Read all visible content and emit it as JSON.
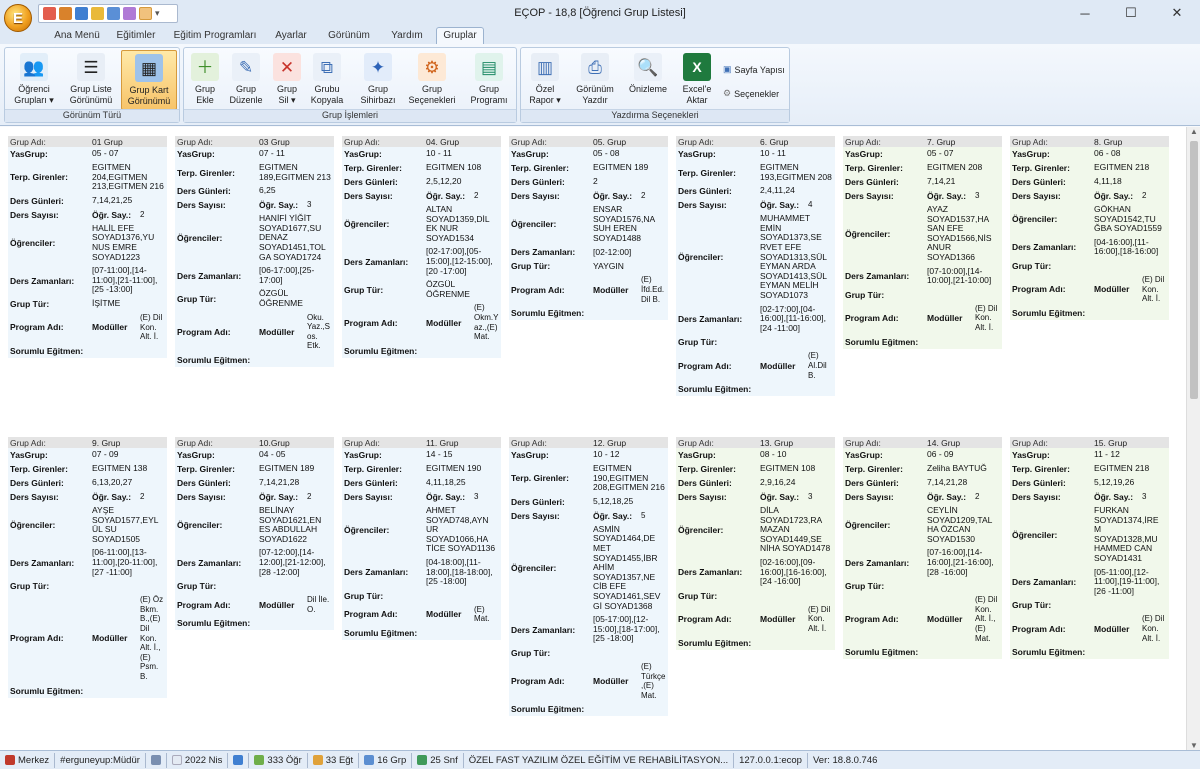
{
  "window": {
    "title": "EÇOP - 18,8 [Öğrenci Grup Listesi]",
    "logo_letter": "E",
    "minimize": "─",
    "maximize": "☐",
    "close": "✕"
  },
  "tabs": [
    "Ana Menü",
    "Eğitimler",
    "Eğitim Programları",
    "Ayarlar",
    "Görünüm",
    "Yardım",
    "Gruplar"
  ],
  "ribbon": {
    "gorunum": {
      "label": "Görünüm Türü",
      "buttons": [
        [
          "Öğrenci",
          "Grupları ▾"
        ],
        [
          "Grup Liste",
          "Görünümü"
        ],
        [
          "Grup Kart",
          "Görünümü"
        ]
      ]
    },
    "islemler": {
      "label": "Grup İşlemleri",
      "buttons": [
        [
          "Grup",
          "Ekle"
        ],
        [
          "Grup",
          "Düzenle"
        ],
        [
          "Grup",
          "Sil ▾"
        ],
        [
          "Grubu",
          "Kopyala"
        ],
        [
          "Grup",
          "Sihirbazı"
        ],
        [
          "Grup",
          "Seçenekleri"
        ],
        [
          "Grup",
          "Programı"
        ]
      ]
    },
    "yazdirma": {
      "label": "Yazdırma Seçenekleri",
      "buttons": [
        [
          "Özel",
          "Rapor ▾"
        ],
        [
          "Görünüm",
          "Yazdır"
        ],
        [
          "Önizleme",
          ""
        ],
        [
          "Excel'e",
          "Aktar"
        ]
      ],
      "sayfa": "Sayfa Yapısı",
      "secenekler": "Seçenekler"
    }
  },
  "labels": {
    "grup_adi": "Grup Adı",
    "yasgrup": "YasGrup",
    "terp": "Terp. Girenler",
    "ders_gunleri": "Ders Günleri",
    "ders_sayisi": "Ders Sayısı",
    "ogr_say": "Öğr. Say.:",
    "ogrenciler": "Öğrenciler",
    "ders_zamanlari": "Ders Zamanları",
    "grup_tur": "Grup Tür",
    "program_adi": "Program Adı",
    "moduller": "Modüller",
    "sorumlu": "Sorumlu Eğitmen"
  },
  "cards": [
    {
      "name": "01 Grup",
      "yas": "05 - 07",
      "terp": "EGITMEN 204,EGITMEN 213,EGITMEN 216",
      "gun": "7,14,21,25",
      "sayi": "",
      "ogr": "2",
      "ogrenciler": "HALİL EFE SOYAD1376,YU NUS EMRE SOYAD1223",
      "zaman": "[07-11:00],[14-11:00],[21-11:00],[25 -13:00]",
      "tur": "İŞİTME",
      "program": "",
      "modul": "(E) Dil Kon. Alt. İ.",
      "sorumlu": ""
    },
    {
      "name": "03 Grup",
      "yas": "07 - 11",
      "terp": "EGITMEN 189,EGITMEN 213",
      "gun": "6,25",
      "sayi": "",
      "ogr": "3",
      "ogrenciler": "HANİFİ YİĞİT SOYAD1677,SU DENAZ SOYAD1451,TOL GA SOYAD1724",
      "zaman": "[06-17:00],[25-17:00]",
      "tur": "ÖZGÜL ÖĞRENME",
      "program": "",
      "modul": "Oku. Yaz.,S os. Etk.",
      "sorumlu": ""
    },
    {
      "name": "04. Grup",
      "yas": "10 - 11",
      "terp": "EGITMEN 108",
      "gun": "2,5,12,20",
      "sayi": "",
      "ogr": "2",
      "ogrenciler": "ALTAN SOYAD1359,DİL EK NUR SOYAD1534",
      "zaman": "[02-17:00],[05-15:00],[12-15:00],[20 -17:00]",
      "tur": "ÖZGÜL ÖĞRENME",
      "program": "",
      "modul": "(E) Okm.Y az.,(E) Mat.",
      "sorumlu": ""
    },
    {
      "name": "05. Grup",
      "yas": "05 - 08",
      "terp": "EGITMEN 189",
      "gun": "2",
      "sayi": "",
      "ogr": "2",
      "ogrenciler": "ENSAR SOYAD1576,NA SUH EREN SOYAD1488",
      "zaman": "[02-12:00]",
      "tur": "YAYGIN",
      "program": "",
      "modul": "(E) İfd.Ed. Dil B.",
      "sorumlu": ""
    },
    {
      "name": "6. Grup",
      "yas": "10 - 11",
      "terp": "EGITMEN 193,EGITMEN 208",
      "gun": "2,4,11,24",
      "sayi": "",
      "ogr": "4",
      "ogrenciler": "MUHAMMET EMİN SOYAD1373,SE RVET EFE SOYAD1313,SÜL EYMAN ARDA SOYAD1413,SÜL EYMAN MELİH SOYAD1073",
      "zaman": "[02-17:00],[04-16:00],[11-16:00],[24 -11:00]",
      "tur": "",
      "program": "",
      "modul": "(E) Al.Dil B.",
      "sorumlu": ""
    },
    {
      "name": "7. Grup",
      "yas": "05 - 07",
      "terp": "EGITMEN 208",
      "gun": "7,14,21",
      "sayi": "",
      "ogr": "3",
      "ogrenciler": "AYAZ SOYAD1537,HA SAN EFE SOYAD1566,NİS ANUR SOYAD1366",
      "zaman": "[07-10:00],[14-10:00],[21-10:00]",
      "tur": "",
      "program": "",
      "modul": "(E) Dil Kon. Alt. İ.",
      "sorumlu": ""
    },
    {
      "name": "8. Grup",
      "yas": "06 - 08",
      "terp": "EGITMEN 218",
      "gun": "4,11,18",
      "sayi": "",
      "ogr": "2",
      "ogrenciler": "GÖKHAN SOYAD1542,TU ĞBA SOYAD1559",
      "zaman": "[04-16:00],[11-16:00],[18-16:00]",
      "tur": "",
      "program": "",
      "modul": "(E) Dil Kon. Alt. İ.",
      "sorumlu": ""
    },
    {
      "name": "9. Grup",
      "yas": "07 - 09",
      "terp": "EGITMEN 138",
      "gun": "6,13,20,27",
      "sayi": "",
      "ogr": "2",
      "ogrenciler": "AYŞE SOYAD1577,EYL ÜL SU SOYAD1505",
      "zaman": "[06-11:00],[13-11:00],[20-11:00],[27 -11:00]",
      "tur": "",
      "program": "",
      "modul": "(E) Öz Bkm. B.,(E) Dil Kon. Alt. İ.,(E) Psm. B.",
      "sorumlu": ""
    },
    {
      "name": "10.Grup",
      "yas": "04 - 05",
      "terp": "EGITMEN 189",
      "gun": "7,14,21,28",
      "sayi": "",
      "ogr": "2",
      "ogrenciler": "BELİNAY SOYAD1621,EN ES ABDULLAH SOYAD1622",
      "zaman": "[07-12:00],[14-12:00],[21-12:00],[28 -12:00]",
      "tur": "",
      "program": "",
      "modul": "Dil İle. O.",
      "sorumlu": ""
    },
    {
      "name": "11. Grup",
      "yas": "14 - 15",
      "terp": "EGITMEN 190",
      "gun": "4,11,18,25",
      "sayi": "",
      "ogr": "3",
      "ogrenciler": "AHMET SOYAD748,AYN UR SOYAD1066,HA TİCE SOYAD1136",
      "zaman": "[04-18:00],[11-18:00],[18-18:00],[25 -18:00]",
      "tur": "",
      "program": "",
      "modul": "(E) Mat.",
      "sorumlu": ""
    },
    {
      "name": "12. Grup",
      "yas": "10 - 12",
      "terp": "EGITMEN 190,EGITMEN 208,EGITMEN 216",
      "gun": "5,12,18,25",
      "sayi": "",
      "ogr": "5",
      "ogrenciler": "ASMİN SOYAD1464,DE MET SOYAD1455,İBR AHİM SOYAD1357,NE CİB EFE SOYAD1461,SEV Gİ SOYAD1368",
      "zaman": "[05-17:00],[12-15:00],[18-17:00],[25 -18:00]",
      "tur": "",
      "program": "",
      "modul": "(E) Türkçe ,(E) Mat.",
      "sorumlu": ""
    },
    {
      "name": "13. Grup",
      "yas": "08 - 10",
      "terp": "EGITMEN 108",
      "gun": "2,9,16,24",
      "sayi": "",
      "ogr": "3",
      "ogrenciler": "DİLA SOYAD1723,RA MAZAN SOYAD1449,SE NİHA SOYAD1478",
      "zaman": "[02-16:00],[09-16:00],[16-16:00],[24 -16:00]",
      "tur": "",
      "program": "",
      "modul": "(E) Dil Kon. Alt. İ.",
      "sorumlu": ""
    },
    {
      "name": "14. Grup",
      "yas": "06 - 09",
      "terp": "Zeliha BAYTUĞ",
      "gun": "7,14,21,28",
      "sayi": "",
      "ogr": "2",
      "ogrenciler": "CEYLİN SOYAD1209,TAL HA ÖZCAN SOYAD1530",
      "zaman": "[07-16:00],[14-16:00],[21-16:00],[28 -16:00]",
      "tur": "",
      "program": "",
      "modul": "(E) Dil Kon. Alt. İ.,(E) Mat.",
      "sorumlu": ""
    },
    {
      "name": "15. Grup",
      "yas": "11 - 12",
      "terp": "EGITMEN 218",
      "gun": "5,12,19,26",
      "sayi": "",
      "ogr": "3",
      "ogrenciler": "FURKAN SOYAD1374,İRE M SOYAD1328,MU HAMMED CAN SOYAD1431",
      "zaman": "[05-11:00],[12-11:00],[19-11:00],[26 -11:00]",
      "tur": "",
      "program": "",
      "modul": "(E) Dil Kon. Alt. İ.",
      "sorumlu": ""
    }
  ],
  "status": {
    "merkez": "Merkez",
    "user": "#erguneyup:Müdür",
    "date": "2022 Nis",
    "ogr": "333 Öğr",
    "egt": "33 Eğt",
    "grp": "16 Grp",
    "snf": "25 Snf",
    "org": "ÖZEL FAST YAZILIM ÖZEL EĞİTİM VE REHABİLİTASYON...",
    "host": "127.0.0.1:ecop",
    "ver": "Ver: 18.8.0.746"
  }
}
